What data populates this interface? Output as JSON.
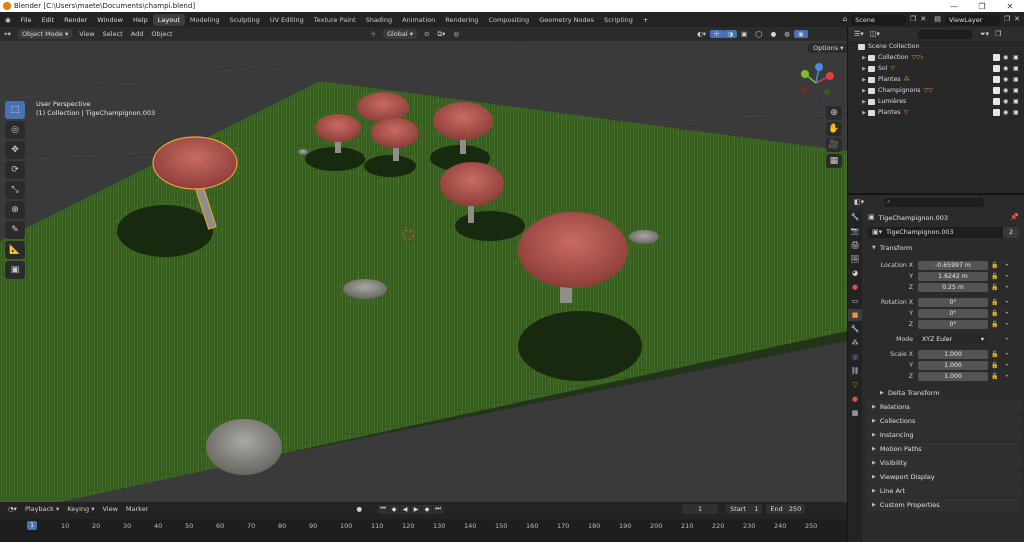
{
  "titlebar": {
    "title": "Blender [C:\\Users\\maete\\Documents\\champi.blend]",
    "minimize": "—",
    "maximize": "❐",
    "close": "✕"
  },
  "menubar": {
    "menus": [
      "File",
      "Edit",
      "Render",
      "Window",
      "Help"
    ],
    "workspaces": [
      "Layout",
      "Modeling",
      "Sculpting",
      "UV Editing",
      "Texture Paint",
      "Shading",
      "Animation",
      "Rendering",
      "Compositing",
      "Geometry Nodes",
      "Scripting"
    ],
    "active_workspace": "Layout",
    "scene": "Scene",
    "view_layer": "ViewLayer"
  },
  "viewport_header": {
    "mode": "Object Mode",
    "menus": [
      "View",
      "Select",
      "Add",
      "Object"
    ],
    "orientation": "Global"
  },
  "viewport": {
    "info_line1": "User Perspective",
    "info_line2": "(1) Collection | TigeChampignon.003",
    "options": "Options"
  },
  "timeline": {
    "menus": [
      "Playback",
      "Keying",
      "View",
      "Marker"
    ],
    "current_frame": "1",
    "start_label": "Start",
    "start": "1",
    "end_label": "End",
    "end": "250",
    "ticks": [
      "1",
      "10",
      "20",
      "30",
      "40",
      "50",
      "60",
      "70",
      "80",
      "90",
      "100",
      "110",
      "120",
      "130",
      "140",
      "150",
      "160",
      "170",
      "180",
      "190",
      "200",
      "210",
      "220",
      "230",
      "240",
      "250"
    ]
  },
  "outliner": {
    "root": "Scene Collection",
    "rows": [
      {
        "name": "Collection"
      },
      {
        "name": "Sol"
      },
      {
        "name": "Plantes"
      },
      {
        "name": "Champignons"
      },
      {
        "name": "Lumières"
      },
      {
        "name": "Plantes"
      }
    ]
  },
  "properties": {
    "object_name": "TigeChampignon.003",
    "datablock": "TigeChampignon.003",
    "users": "2",
    "transform": {
      "title": "Transform",
      "location_label": "Location X",
      "loc_x": "-0.65997 m",
      "loc_y": "1.6242 m",
      "loc_z": "0.25 m",
      "rotation_label": "Rotation X",
      "rot_x": "0°",
      "rot_y": "0°",
      "rot_z": "0°",
      "mode_label": "Mode",
      "mode": "XYZ Euler",
      "scale_label": "Scale X",
      "scale_x": "1.000",
      "scale_y": "1.000",
      "scale_z": "1.000",
      "y_label": "Y",
      "z_label": "Z"
    },
    "panels": [
      "Delta Transform",
      "Relations",
      "Collections",
      "Instancing",
      "Motion Paths",
      "Visibility",
      "Viewport Display",
      "Line Art",
      "Custom Properties"
    ]
  }
}
